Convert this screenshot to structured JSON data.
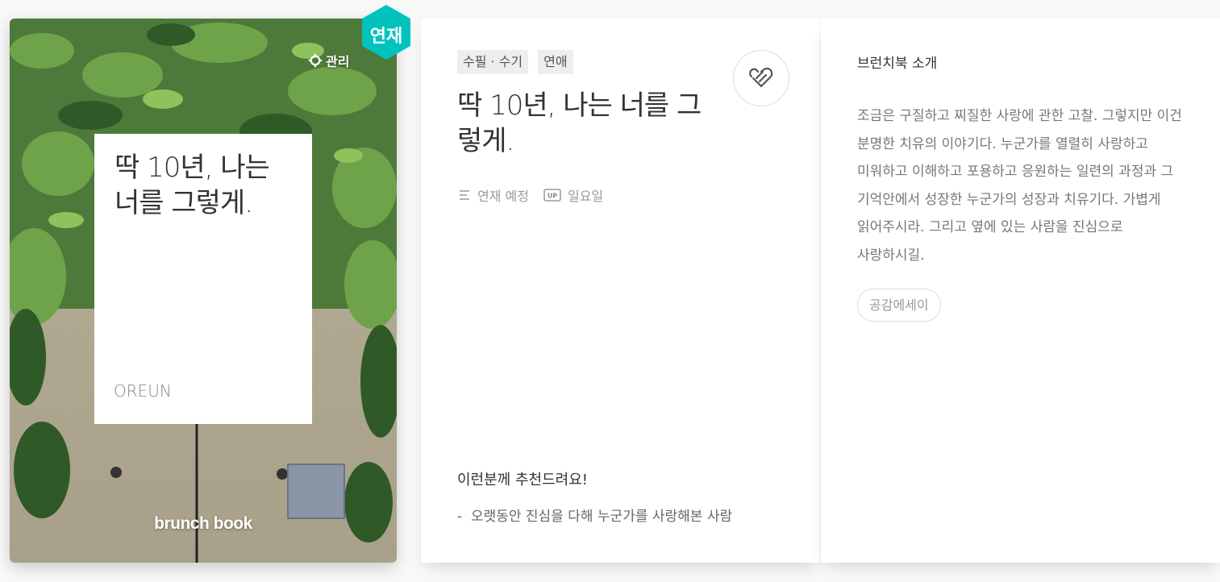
{
  "cover": {
    "manage_label": "관리",
    "serial_badge": "연재",
    "title": "딱 10년, 나는 너를 그렇게.",
    "author": "OREUN",
    "brand": "brunch book"
  },
  "book": {
    "tags": [
      "수필 · 수기",
      "연애"
    ],
    "title": "딱 10년, 나는 너를 그렇게.",
    "schedule": "연재 예정",
    "up_badge": "UP",
    "publish_day": "일요일",
    "recommend_title": "이런분께 추천드려요!",
    "recommend_items": [
      "오랫동안 진심을 다해 누군가를 사랑해본 사람"
    ]
  },
  "intro": {
    "heading": "브런치북 소개",
    "body": "조금은 구질하고 찌질한 사랑에 관한 고찰. 그렇지만 이건 분명한 치유의 이야기다. 누군가를 열렬히 사랑하고 미워하고 이해하고 포용하고 응원하는 일련의 과정과 그 기억안에서 성장한 누군가의 성장과 치유기다. 가볍게 읽어주시라. 그리고 옆에 있는 사람을 진심으로 사랑하시길.",
    "keyword": "공감에세이"
  },
  "colors": {
    "accent": "#00c3bd",
    "page_bg": "#f8f8f8"
  }
}
